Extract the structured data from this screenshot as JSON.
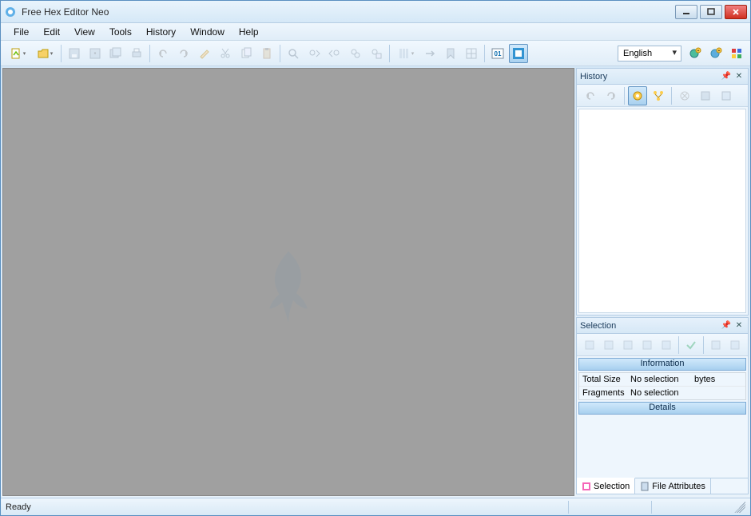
{
  "title": "Free Hex Editor Neo",
  "menu": [
    "File",
    "Edit",
    "View",
    "Tools",
    "History",
    "Window",
    "Help"
  ],
  "toolbar": {
    "groups": [
      [
        {
          "icon": "new-file",
          "enabled": true,
          "dd": true
        },
        {
          "icon": "open-file",
          "enabled": true,
          "dd": true
        }
      ],
      [
        {
          "icon": "save",
          "enabled": false
        },
        {
          "icon": "save-as",
          "enabled": false
        },
        {
          "icon": "save-all",
          "enabled": false
        },
        {
          "icon": "print",
          "enabled": false
        }
      ],
      [
        {
          "icon": "undo",
          "enabled": false
        },
        {
          "icon": "redo",
          "enabled": false
        },
        {
          "icon": "history-edit",
          "enabled": false
        },
        {
          "icon": "cut",
          "enabled": false
        },
        {
          "icon": "copy",
          "enabled": false
        },
        {
          "icon": "paste",
          "enabled": false
        }
      ],
      [
        {
          "icon": "find",
          "enabled": false
        },
        {
          "icon": "find-next",
          "enabled": false
        },
        {
          "icon": "find-prev",
          "enabled": false
        },
        {
          "icon": "replace",
          "enabled": false
        },
        {
          "icon": "find-in-files",
          "enabled": false
        }
      ],
      [
        {
          "icon": "columns",
          "enabled": false,
          "dd": true
        },
        {
          "icon": "goto",
          "enabled": false
        },
        {
          "icon": "bookmark",
          "enabled": false
        },
        {
          "icon": "grid",
          "enabled": false
        }
      ],
      [
        {
          "icon": "binary01",
          "enabled": true
        },
        {
          "icon": "fullscreen",
          "enabled": true,
          "active": true
        }
      ]
    ],
    "language": "English",
    "right_buttons": [
      {
        "icon": "globe-plus"
      },
      {
        "icon": "globe-plus2"
      },
      {
        "icon": "flags"
      }
    ]
  },
  "panels": {
    "history": {
      "title": "History",
      "buttons": [
        {
          "icon": "undo-sm",
          "enabled": false
        },
        {
          "icon": "redo-sm",
          "enabled": false
        },
        {
          "icon": "hist-view",
          "enabled": true,
          "active": true
        },
        {
          "icon": "hist-tree",
          "enabled": true
        },
        {
          "icon": "hist-clear",
          "enabled": false
        },
        {
          "icon": "hist-save",
          "enabled": false
        },
        {
          "icon": "hist-load",
          "enabled": false
        }
      ]
    },
    "selection": {
      "title": "Selection",
      "buttons": [
        {
          "icon": "sel1",
          "enabled": false
        },
        {
          "icon": "sel2",
          "enabled": false
        },
        {
          "icon": "sel3",
          "enabled": false
        },
        {
          "icon": "sel4",
          "enabled": false
        },
        {
          "icon": "sel5",
          "enabled": false
        },
        {
          "icon": "check",
          "enabled": false
        },
        {
          "icon": "sel6",
          "enabled": false
        },
        {
          "icon": "sel7",
          "enabled": false
        }
      ],
      "info_header": "Information",
      "rows": [
        {
          "label": "Total Size",
          "value": "No selection",
          "unit": "bytes"
        },
        {
          "label": "Fragments",
          "value": "No selection",
          "unit": ""
        }
      ],
      "details_header": "Details",
      "tabs": [
        {
          "label": "Selection",
          "active": true
        },
        {
          "label": "File Attributes",
          "active": false
        }
      ]
    }
  },
  "statusbar": {
    "text": "Ready"
  }
}
